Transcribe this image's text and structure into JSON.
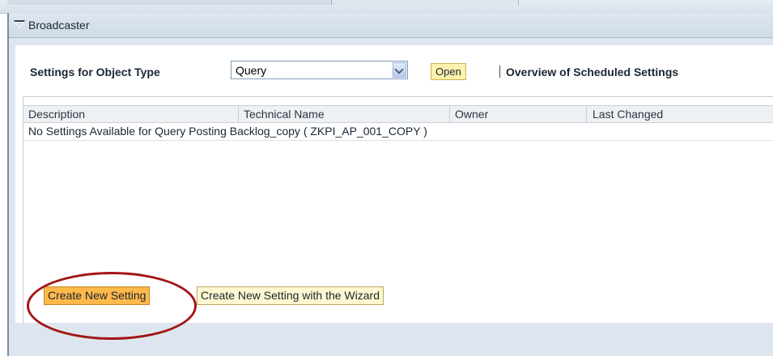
{
  "panel": {
    "title": "Broadcaster"
  },
  "settings": {
    "label": "Settings for Object Type",
    "object_type_value": "Query",
    "open_label": "Open",
    "overview_label": "Overview of Scheduled Settings"
  },
  "table": {
    "columns": [
      "Description",
      "Technical Name",
      "Owner",
      "Last Changed"
    ],
    "rows": [
      "No Settings Available for Query Posting Backlog_copy ( ZKPI_AP_001_COPY )"
    ]
  },
  "actions": {
    "create_label": "Create New Setting",
    "wizard_label": "Create New Setting with the Wizard"
  },
  "colors": {
    "accent_orange": "#ffb84a",
    "highlight_ring": "#a31515",
    "panel_bg": "#dde6ef"
  }
}
